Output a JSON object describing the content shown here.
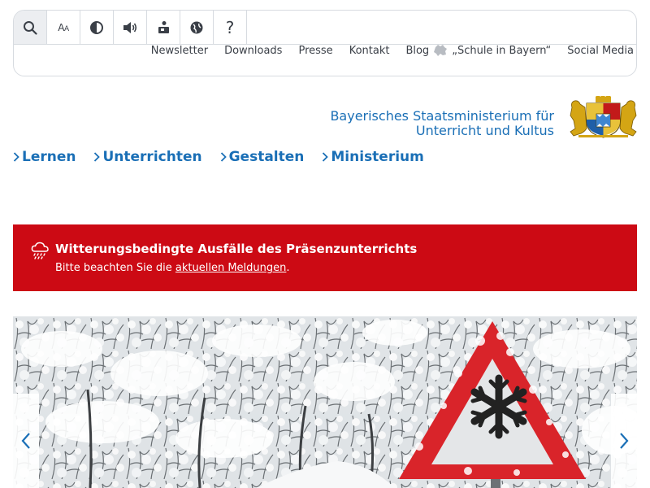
{
  "toolbar": {
    "icons": [
      "search-icon",
      "font-size-icon",
      "contrast-icon",
      "audio-icon",
      "sign-language-icon",
      "language-icon",
      "help-icon"
    ],
    "font_size_label_large": "A",
    "font_size_label_small": "A",
    "help_label": "?"
  },
  "service_links": [
    "Newsletter",
    "Downloads",
    "Presse",
    "Kontakt",
    "Blog",
    "„Schule in Bayern“",
    "Social Media"
  ],
  "header": {
    "ministry_line1": "Bayerisches Staatsministerium für",
    "ministry_line2": "Unterricht und Kultus"
  },
  "main_nav": [
    "Lernen",
    "Unterrichten",
    "Gestalten",
    "Ministerium"
  ],
  "alert": {
    "title": "Witterungsbedingte Ausfälle des Präsenzunterrichts",
    "text_before": "Bitte beachten Sie die ",
    "link": "aktuellen Meldungen",
    "text_after": "."
  },
  "colors": {
    "brand_blue": "#1a6fb6",
    "alert_red": "#cc0a14"
  }
}
